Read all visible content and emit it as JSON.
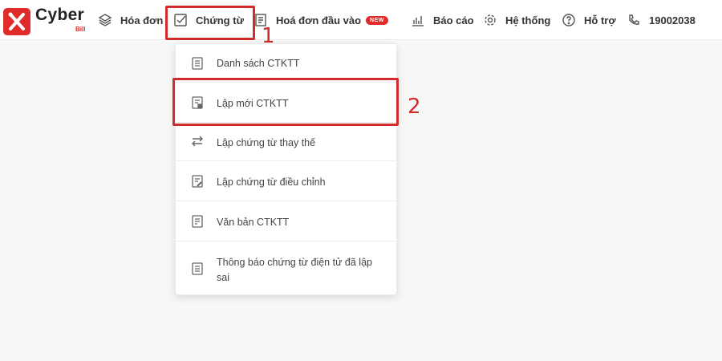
{
  "logo": {
    "brand": "Cyber",
    "sub": "Bill"
  },
  "nav": {
    "hoa_don": "Hóa đơn",
    "chung_tu": "Chứng từ",
    "hoa_don_dau_vao": "Hoá đơn đầu vào",
    "new_badge": "NEW",
    "bao_cao": "Báo cáo",
    "he_thong": "Hệ thống",
    "ho_tro": "Hỗ trợ",
    "hotline": "19002038"
  },
  "dropdown": {
    "items": [
      {
        "label": "Danh sách CTKTT",
        "icon": "document-list-icon"
      },
      {
        "label": "Lập mới CTKTT",
        "icon": "document-new-icon"
      },
      {
        "label": "Lập chứng từ thay thế",
        "icon": "swap-arrows-icon"
      },
      {
        "label": "Lập chứng từ điều chỉnh",
        "icon": "document-edit-icon"
      },
      {
        "label": "Văn bản CTKTT",
        "icon": "document-text-icon"
      },
      {
        "label": "Thông báo chứng từ điện tử đã lập sai",
        "icon": "document-notice-icon"
      }
    ]
  },
  "annotations": {
    "step1": "1",
    "step2": "2"
  },
  "colors": {
    "accent": "#e02b2b",
    "highlight": "#d22b2b"
  }
}
